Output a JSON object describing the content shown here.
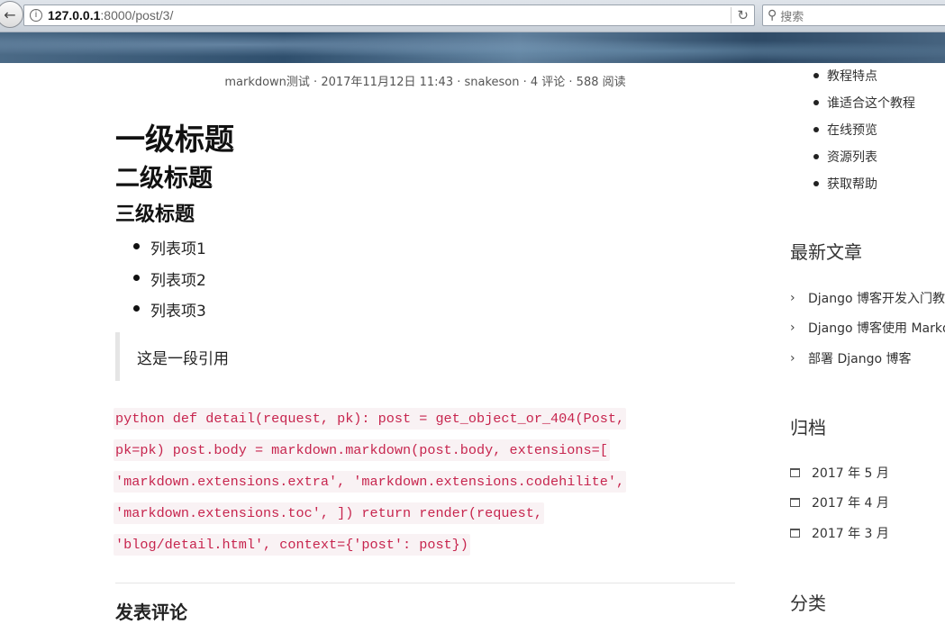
{
  "browser": {
    "back_icon": "back-arrow-icon",
    "url_host": "127.0.0.1",
    "url_rest": ":8000/post/3/",
    "search_placeholder": "搜索"
  },
  "post": {
    "meta": "markdown测试 · 2017年11月12日 11:43 · snakeson · 4 评论 · 588 阅读",
    "h1": "一级标题",
    "h2": "二级标题",
    "h3": "三级标题",
    "list_items": [
      "列表项1",
      "列表项2",
      "列表项3"
    ],
    "quote": "这是一段引用",
    "code_lines": [
      "python def detail(request, pk): post = get_object_or_404(Post,",
      "pk=pk) post.body = markdown.markdown(post.body, extensions=[",
      "'markdown.extensions.extra', 'markdown.extensions.codehilite',",
      "'markdown.extensions.toc', ]) return render(request,",
      "'blog/detail.html', context={'post': post})"
    ],
    "next_heading_partial": "发表评论"
  },
  "sidebar": {
    "toc_items": [
      "教程特点",
      "谁适合这个教程",
      "在线预览",
      "资源列表",
      "获取帮助"
    ],
    "recent_title": "最新文章",
    "recent_items": [
      "Django 博客开发入门教程",
      "Django 博客使用 Markdown",
      "部署 Django 博客"
    ],
    "archive_title": "归档",
    "archive_items": [
      "2017 年 5 月",
      "2017 年 4 月",
      "2017 年 3 月"
    ],
    "category_title": "分类"
  }
}
